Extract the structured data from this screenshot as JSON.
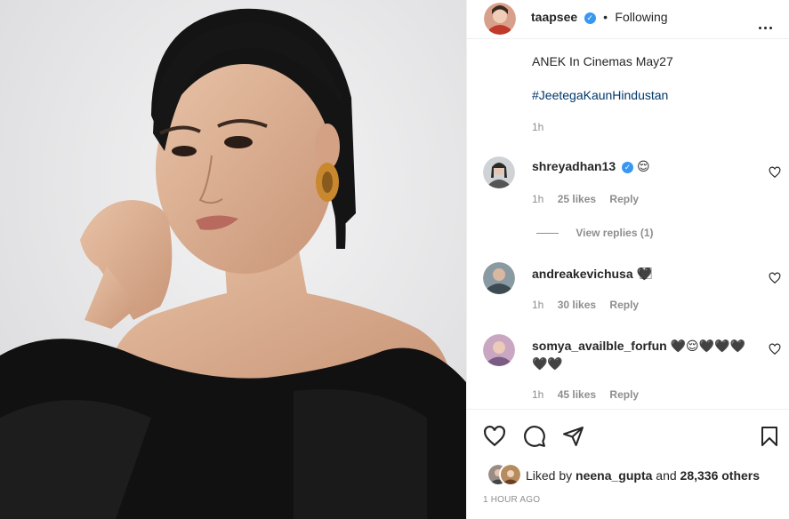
{
  "post": {
    "username": "taapsee",
    "separator": "•",
    "follow_status": "Following",
    "caption_line1": "ANEK In Cinemas May27",
    "hashtag": "#JeetegaKaunHindustan",
    "caption_time": "1h"
  },
  "comments": [
    {
      "username": "shreyadhan13",
      "text": "😌",
      "time": "1h",
      "likes": "25 likes",
      "reply": "Reply",
      "view_replies": "View replies (1)"
    },
    {
      "username": "andreakevichusa",
      "text": "🖤⃞",
      "time": "1h",
      "likes": "30 likes",
      "reply": "Reply"
    },
    {
      "username": "somya_availble_forfun",
      "text": "🖤😌🖤🖤🖤",
      "text2": "🖤🖤",
      "time": "1h",
      "likes": "45 likes",
      "reply": "Reply"
    }
  ],
  "likes": {
    "prefix": "Liked by",
    "user": "neena_gupta",
    "and": "and",
    "count": "28,336 others"
  },
  "timestamp": "1 HOUR AGO",
  "colors": {
    "accent": "#3897f0",
    "link": "#00376b",
    "muted": "#8e8e8e"
  },
  "icons": [
    "verified-badge",
    "more-icon",
    "heart-icon",
    "comment-icon",
    "share-icon",
    "save-icon"
  ]
}
